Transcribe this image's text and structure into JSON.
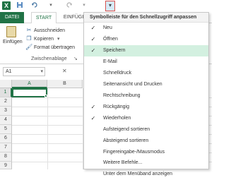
{
  "qat": {
    "app_icon": "X",
    "customize_icon": "▾",
    "icons": [
      "save-icon",
      "undo-icon",
      "undo-dropdown-icon",
      "redo-icon",
      "redo-dropdown-icon",
      "customize-qat-icon"
    ]
  },
  "ribbon": {
    "tabs": {
      "file": "DATEI",
      "start": "START",
      "insert": "EINFÜGEN"
    },
    "paste_label": "Einfügen",
    "cut_label": "Ausschneiden",
    "copy_label": "Kopieren",
    "copy_dropdown": "▾",
    "format_painter_label": "Format übertragen",
    "clipboard_group_label": "Zwischenablage",
    "clipboard_launcher": "↘"
  },
  "formula": {
    "name_box_value": "A1",
    "name_box_arrow": "▾",
    "cancel_icon": "✕"
  },
  "grid": {
    "columns": [
      "A",
      "B"
    ],
    "rows": [
      "1",
      "2",
      "3",
      "4",
      "5",
      "6",
      "7",
      "8",
      "9",
      "10"
    ]
  },
  "menu": {
    "title": "Symbolleiste für den Schnellzugriff anpassen",
    "items": [
      {
        "label": "Neu",
        "checked": "✓",
        "highlighted": false
      },
      {
        "label": "Öffnen",
        "checked": "✓",
        "highlighted": false
      },
      {
        "label": "Speichern",
        "checked": "✓",
        "highlighted": true
      },
      {
        "label": "E-Mail",
        "checked": "",
        "highlighted": false
      },
      {
        "label": "Schnelldruck",
        "checked": "",
        "highlighted": false
      },
      {
        "label": "Seitenansicht und Drucken",
        "checked": "",
        "highlighted": false
      },
      {
        "label": "Rechtschreibung",
        "checked": "",
        "highlighted": false
      },
      {
        "label": "Rückgängig",
        "checked": "✓",
        "highlighted": false
      },
      {
        "label": "Wiederholen",
        "checked": "✓",
        "highlighted": false
      },
      {
        "label": "Aufsteigend sortieren",
        "checked": "",
        "highlighted": false
      },
      {
        "label": "Absteigend sortieren",
        "checked": "",
        "highlighted": false
      },
      {
        "label": "Fingereingabe-/Mausmodus",
        "checked": "",
        "highlighted": false
      },
      {
        "label": "Weitere Befehle...",
        "checked": "",
        "highlighted": false
      },
      {
        "label": "Unter dem Menüband anzeigen",
        "checked": "",
        "highlighted": false
      }
    ]
  }
}
